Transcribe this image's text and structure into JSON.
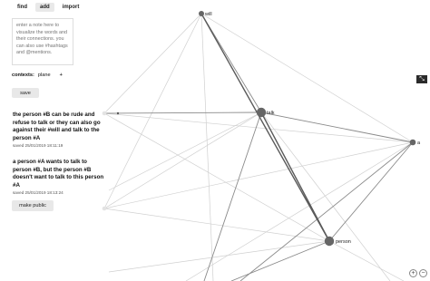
{
  "tabs": [
    {
      "label": "find",
      "active": false
    },
    {
      "label": "add",
      "active": true
    },
    {
      "label": "import",
      "active": false
    }
  ],
  "editor": {
    "placeholder": "enter a note here to visualize the words and their connections. you can also use #hashtags and @mentions."
  },
  "contexts": {
    "label": "contexts:",
    "value": "plane",
    "add": "+"
  },
  "buttons": {
    "save": "save",
    "make_public": "make public"
  },
  "notes": [
    {
      "text": "the person #B can be rude and refuse to talk or they can also go against their #will and talk to the person #A",
      "saved": "saved 25/01/2019 18:11:19"
    },
    {
      "text": "a person #A wants to talk to person #B, but the person #B doesn't want to talk to this person #A",
      "saved": "saved 25/01/2019 18:13:24"
    }
  ],
  "graph": {
    "nodes": [
      {
        "id": "will",
        "label": "will",
        "size": "small"
      },
      {
        "id": "talk",
        "label": "talk",
        "size": "large"
      },
      {
        "id": "a",
        "label": "a",
        "size": "small"
      },
      {
        "id": "person",
        "label": "person",
        "size": "large"
      }
    ]
  },
  "icons": {
    "corner": "expand-icon",
    "zoom_in": "zoom-in-icon",
    "zoom_out": "zoom-out-icon"
  }
}
